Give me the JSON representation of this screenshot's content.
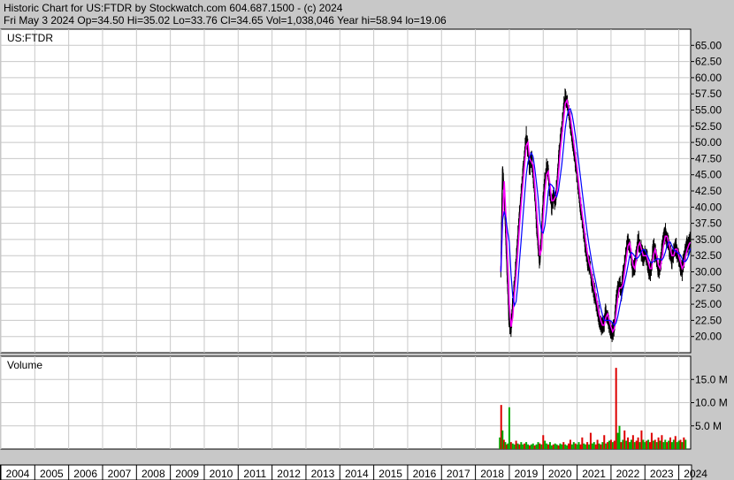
{
  "header": {
    "line1": "Historic Chart for US:FTDR by Stockwatch.com 604.687.1500 - (c) 2024",
    "line2": "Fri May  3 2024   Op=34.50   Hi=35.02   Lo=33.76   Cl=34.65   Vol=1,038,046   Year hi=58.94   lo=19.06"
  },
  "colors": {
    "background": "#c8c8c8",
    "panel": "#ffffff",
    "grid": "#c8c8c8",
    "price": "#000000",
    "ma_short": "#ff00ff",
    "ma_long": "#0000ff",
    "vol_up": "#00aa00",
    "vol_down": "#dd0000"
  },
  "chart_data": [
    {
      "type": "line",
      "symbol": "US:FTDR",
      "ylim": [
        17.5,
        67.5
      ],
      "yticks": [
        "65.00",
        "62.50",
        "60.00",
        "57.50",
        "55.00",
        "52.50",
        "50.00",
        "47.50",
        "45.00",
        "42.50",
        "40.00",
        "37.50",
        "35.00",
        "32.50",
        "30.00",
        "27.50",
        "25.00",
        "22.50",
        "20.00"
      ],
      "x_labels": [
        "2004",
        "2005",
        "2006",
        "2007",
        "2008",
        "2009",
        "2010",
        "2011",
        "2012",
        "2013",
        "2014",
        "2015",
        "2016",
        "2017",
        "2018",
        "2019",
        "2020",
        "2021",
        "2022",
        "2023",
        "2024"
      ],
      "xlim": [
        2004.0,
        2024.35
      ],
      "series": [
        {
          "x": [
            2018.75,
            2018.8,
            2018.85,
            2018.9,
            2018.95,
            2019.0,
            2019.05,
            2019.1,
            2019.15,
            2019.2,
            2019.25,
            2019.3,
            2019.35,
            2019.4,
            2019.45,
            2019.5,
            2019.55,
            2019.6,
            2019.65,
            2019.7,
            2019.75,
            2019.8,
            2019.85,
            2019.9,
            2019.95,
            2020.0,
            2020.05,
            2020.1,
            2020.15,
            2020.2,
            2020.25,
            2020.3,
            2020.35,
            2020.4,
            2020.45,
            2020.5,
            2020.55,
            2020.6,
            2020.65,
            2020.7,
            2020.75,
            2020.8,
            2020.85,
            2020.9,
            2020.95,
            2021.0,
            2021.05,
            2021.1,
            2021.15,
            2021.2,
            2021.25,
            2021.3,
            2021.35,
            2021.4,
            2021.45,
            2021.5,
            2021.55,
            2021.6,
            2021.65,
            2021.7,
            2021.75,
            2021.8,
            2021.85,
            2021.9,
            2021.95,
            2022.0,
            2022.05,
            2022.1,
            2022.15,
            2022.2,
            2022.25,
            2022.3,
            2022.35,
            2022.4,
            2022.45,
            2022.5,
            2022.55,
            2022.6,
            2022.65,
            2022.7,
            2022.75,
            2022.8,
            2022.85,
            2022.9,
            2022.95,
            2023.0,
            2023.05,
            2023.1,
            2023.15,
            2023.2,
            2023.25,
            2023.3,
            2023.35,
            2023.4,
            2023.45,
            2023.5,
            2023.55,
            2023.6,
            2023.65,
            2023.7,
            2023.75,
            2023.8,
            2023.85,
            2023.9,
            2023.95,
            2024.0,
            2024.05,
            2024.1,
            2024.15,
            2024.2,
            2024.25,
            2024.3,
            2024.34
          ],
          "y": [
            30.0,
            46.0,
            42.0,
            35.0,
            28.0,
            22.0,
            21.0,
            25.0,
            28.0,
            31.0,
            35.0,
            39.0,
            42.0,
            45.0,
            48.0,
            51.0,
            49.0,
            46.0,
            48.0,
            45.0,
            42.0,
            38.0,
            34.0,
            31.0,
            36.0,
            41.0,
            44.0,
            46.0,
            45.0,
            42.0,
            40.0,
            42.0,
            41.0,
            43.0,
            47.0,
            50.0,
            52.0,
            55.0,
            57.0,
            56.0,
            55.0,
            53.0,
            51.0,
            49.0,
            47.0,
            45.0,
            42.0,
            40.0,
            38.0,
            36.0,
            34.0,
            32.0,
            31.0,
            30.0,
            28.0,
            27.0,
            26.0,
            24.0,
            23.0,
            22.0,
            21.5,
            22.0,
            24.0,
            23.0,
            22.0,
            21.0,
            20.5,
            22.0,
            25.0,
            27.0,
            28.0,
            27.0,
            29.0,
            31.0,
            33.0,
            35.0,
            34.0,
            32.0,
            30.0,
            31.0,
            33.0,
            35.0,
            34.0,
            33.0,
            32.0,
            33.0,
            32.0,
            31.0,
            30.0,
            31.0,
            34.0,
            33.0,
            32.0,
            30.0,
            31.0,
            33.0,
            35.0,
            36.0,
            35.0,
            34.0,
            33.0,
            32.0,
            33.0,
            34.0,
            33.0,
            32.0,
            31.0,
            30.0,
            32.0,
            33.0,
            34.0,
            34.5,
            34.65
          ]
        }
      ]
    },
    {
      "type": "bar",
      "panel_label": "Volume",
      "ylim": [
        0,
        20
      ],
      "yticks": [
        "15.0 M",
        "10.0 M",
        "5.0 M"
      ],
      "ytick_values": [
        15,
        10,
        5
      ],
      "x": [
        2018.72,
        2018.76,
        2018.8,
        2018.84,
        2018.88,
        2018.92,
        2018.96,
        2019.0,
        2019.05,
        2019.1,
        2019.15,
        2019.2,
        2019.25,
        2019.3,
        2019.35,
        2019.4,
        2019.45,
        2019.5,
        2019.55,
        2019.6,
        2019.65,
        2019.7,
        2019.75,
        2019.8,
        2019.85,
        2019.9,
        2019.95,
        2020.0,
        2020.05,
        2020.1,
        2020.15,
        2020.2,
        2020.25,
        2020.3,
        2020.35,
        2020.4,
        2020.45,
        2020.5,
        2020.55,
        2020.6,
        2020.65,
        2020.7,
        2020.75,
        2020.8,
        2020.85,
        2020.9,
        2020.95,
        2021.0,
        2021.05,
        2021.1,
        2021.15,
        2021.2,
        2021.25,
        2021.3,
        2021.35,
        2021.4,
        2021.45,
        2021.5,
        2021.55,
        2021.6,
        2021.65,
        2021.7,
        2021.75,
        2021.8,
        2021.85,
        2021.9,
        2021.95,
        2022.0,
        2022.05,
        2022.1,
        2022.15,
        2022.2,
        2022.25,
        2022.3,
        2022.35,
        2022.4,
        2022.45,
        2022.5,
        2022.55,
        2022.6,
        2022.65,
        2022.7,
        2022.75,
        2022.8,
        2022.85,
        2022.9,
        2022.95,
        2023.0,
        2023.05,
        2023.1,
        2023.15,
        2023.2,
        2023.25,
        2023.3,
        2023.35,
        2023.4,
        2023.45,
        2023.5,
        2023.55,
        2023.6,
        2023.65,
        2023.7,
        2023.75,
        2023.8,
        2023.85,
        2023.9,
        2023.95,
        2024.0,
        2024.05,
        2024.1,
        2024.15,
        2024.2,
        2024.25,
        2024.3
      ],
      "values": [
        2.5,
        9.5,
        4.0,
        2.0,
        1.5,
        1.0,
        1.2,
        9.0,
        1.5,
        1.2,
        1.0,
        1.8,
        1.2,
        1.0,
        1.5,
        1.0,
        1.2,
        1.5,
        1.0,
        0.8,
        1.0,
        1.2,
        0.8,
        1.0,
        1.5,
        1.2,
        1.0,
        3.0,
        1.8,
        1.2,
        1.0,
        1.5,
        0.8,
        1.0,
        1.2,
        1.0,
        0.8,
        1.2,
        1.0,
        1.5,
        1.0,
        0.8,
        1.2,
        2.0,
        1.0,
        1.5,
        1.2,
        1.0,
        1.5,
        1.0,
        2.5,
        1.2,
        1.0,
        1.5,
        1.0,
        3.5,
        1.2,
        1.5,
        1.0,
        2.0,
        1.2,
        1.0,
        1.5,
        3.0,
        1.2,
        1.5,
        1.8,
        2.0,
        1.5,
        1.8,
        17.5,
        3.5,
        5.0,
        1.5,
        2.0,
        4.0,
        1.8,
        2.5,
        1.5,
        2.0,
        3.0,
        1.5,
        1.8,
        2.5,
        1.5,
        4.0,
        2.0,
        1.5,
        1.8,
        2.0,
        1.5,
        3.5,
        1.8,
        2.0,
        1.5,
        2.5,
        1.8,
        3.0,
        1.5,
        2.0,
        1.5,
        1.8,
        2.5,
        1.5,
        2.0,
        2.8,
        1.5,
        1.8,
        2.0,
        1.5,
        2.5,
        2.0
      ],
      "up": [
        1,
        0,
        1,
        0,
        1,
        0,
        1,
        1,
        0,
        1,
        1,
        0,
        1,
        0,
        1,
        1,
        0,
        1,
        1,
        0,
        1,
        1,
        0,
        1,
        1,
        0,
        1,
        0,
        1,
        1,
        0,
        1,
        1,
        0,
        1,
        1,
        0,
        1,
        1,
        0,
        1,
        1,
        0,
        0,
        1,
        1,
        0,
        1,
        1,
        0,
        0,
        1,
        1,
        0,
        1,
        0,
        1,
        1,
        0,
        0,
        1,
        0,
        1,
        0,
        1,
        0,
        1,
        0,
        1,
        0,
        0,
        1,
        1,
        0,
        1,
        0,
        1,
        0,
        1,
        1,
        0,
        1,
        0,
        0,
        1,
        0,
        1,
        1,
        0,
        1,
        0,
        0,
        1,
        0,
        1,
        0,
        1,
        0,
        1,
        1,
        0,
        1,
        0,
        1,
        1,
        0,
        1,
        1,
        0,
        1,
        0,
        1
      ]
    }
  ]
}
